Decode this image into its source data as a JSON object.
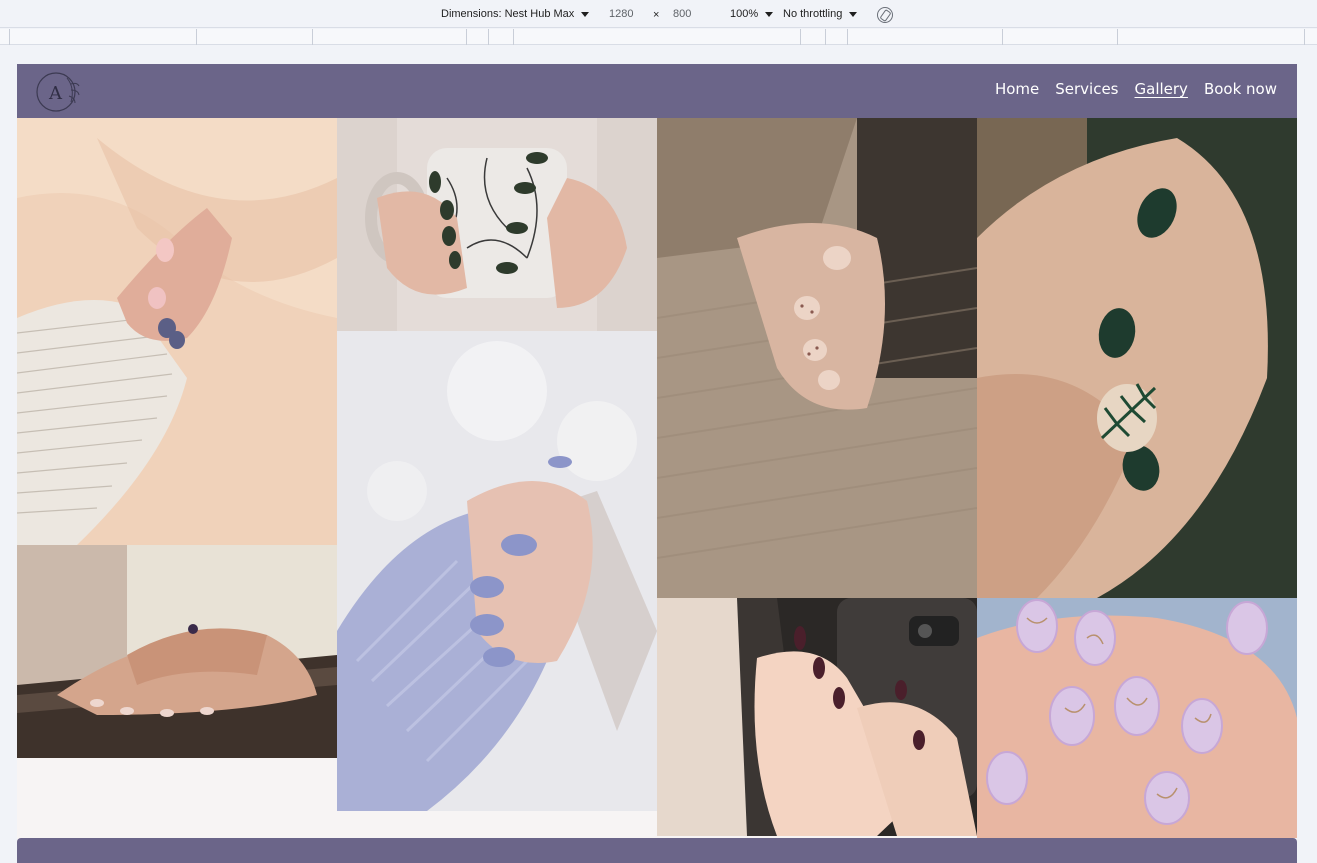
{
  "devtools": {
    "dimensions_label": "Dimensions: Nest Hub Max",
    "width": "1280",
    "times": "×",
    "height": "800",
    "zoom": "100%",
    "throttling": "No throttling"
  },
  "site": {
    "logo_letter": "A",
    "nav": [
      {
        "label": "Home",
        "active": false
      },
      {
        "label": "Services",
        "active": false
      },
      {
        "label": "Gallery",
        "active": true
      },
      {
        "label": "Book now",
        "active": false
      }
    ]
  },
  "gallery": {
    "images": [
      {
        "subject": "hand with pink and navy nail art on peach satin",
        "palette": [
          "#f0d2ba",
          "#e9e4dc",
          "#d9a99c"
        ]
      },
      {
        "subject": "hands holding floral mug with dark green nails",
        "palette": [
          "#ddd4cf",
          "#cfc6c0",
          "#2e3b2c"
        ]
      },
      {
        "subject": "hand with nude polka-dot nails on beige knit sweater",
        "palette": [
          "#b6a593",
          "#8f7d6b",
          "#e6cbbd"
        ]
      },
      {
        "subject": "hand with dark green fern-pattern nails",
        "palette": [
          "#d9b49b",
          "#2f3a2e",
          "#1e3b2e"
        ]
      },
      {
        "subject": "hands with ring on wooden table",
        "palette": [
          "#e8e2d6",
          "#4a3b32",
          "#d4a58c"
        ]
      },
      {
        "subject": "hand with periwinkle nails in lavender knit sleeve",
        "palette": [
          "#e6e6ea",
          "#aab0d6",
          "#8c95c9"
        ]
      },
      {
        "subject": "hands with burgundy nails holding phone",
        "palette": [
          "#2d2a29",
          "#f4dccd",
          "#4a1f2b"
        ]
      },
      {
        "subject": "hands with lilac marble nails on denim",
        "palette": [
          "#a9b8d0",
          "#d9c3e4",
          "#e8b6a2"
        ]
      }
    ]
  }
}
